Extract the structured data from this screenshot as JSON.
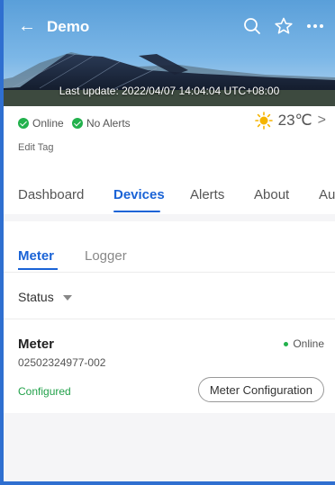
{
  "header": {
    "title": "Demo",
    "back_icon": "arrow-left-icon",
    "icons": [
      "search-icon",
      "star-icon",
      "more-icon"
    ],
    "last_update": "Last update: 2022/04/07 14:04:04 UTC+08:00"
  },
  "status": {
    "online_label": "Online",
    "alerts_label": "No Alerts",
    "weather_icon": "sun-icon",
    "temperature": "23℃",
    "edit_tag": "Edit Tag"
  },
  "tabs": [
    {
      "label": "Dashboard",
      "active": false
    },
    {
      "label": "Devices",
      "active": true
    },
    {
      "label": "Alerts",
      "active": false
    },
    {
      "label": "About",
      "active": false
    },
    {
      "label": "Au",
      "active": false
    }
  ],
  "devices": {
    "subtabs": [
      {
        "label": "Meter",
        "active": true
      },
      {
        "label": "Logger",
        "active": false
      }
    ],
    "status_filter": "Status",
    "item": {
      "name": "Meter",
      "status": "Online",
      "serial": "02502324977-002",
      "config_state": "Configured",
      "button_label": "Meter Configuration"
    }
  },
  "colors": {
    "accent": "#1a63d6",
    "online_green": "#22b14c",
    "sun": "#f5b400"
  }
}
